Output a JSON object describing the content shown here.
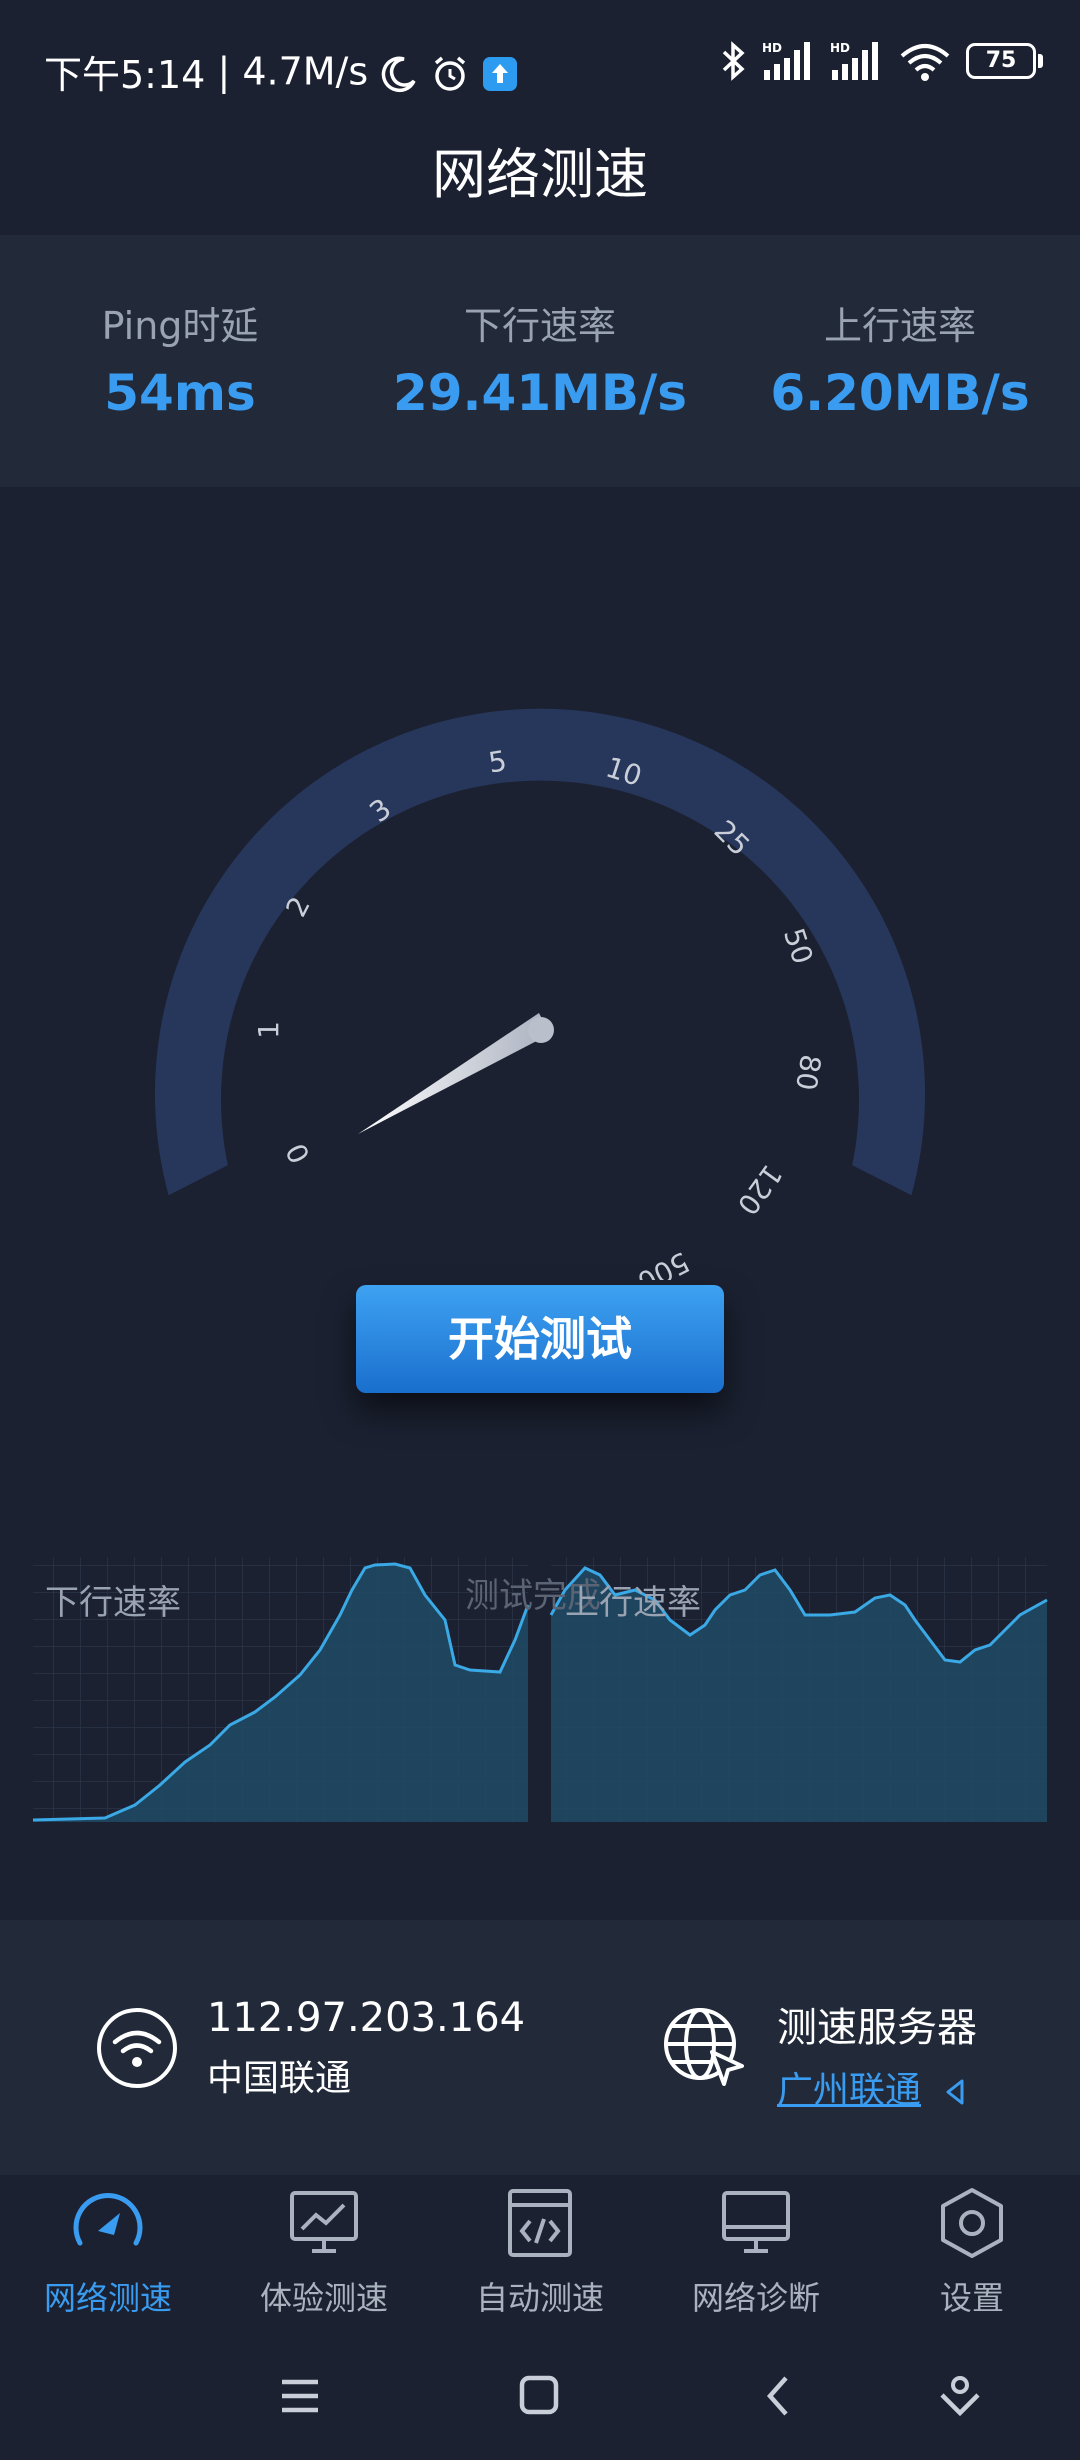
{
  "status_bar": {
    "time": "下午5:14",
    "speed": "4.7M/s",
    "battery": "75",
    "colors": {
      "icon": "#ffffff",
      "notification_badge": "#2d9cf0"
    }
  },
  "app": {
    "title": "网络测速"
  },
  "stats": [
    {
      "label": "Ping时延",
      "value": "54ms"
    },
    {
      "label": "下行速率",
      "value": "29.41MB/s"
    },
    {
      "label": "上行速率",
      "value": "6.20MB/s"
    }
  ],
  "gauge": {
    "ticks": [
      "0",
      "1",
      "2",
      "3",
      "5",
      "10",
      "25",
      "50",
      "80",
      "120",
      "500"
    ],
    "needle_value_fraction": 0.0,
    "colors": {
      "track": "#27375b",
      "dial": "#1b2131",
      "needle": "#c9ced8"
    }
  },
  "start_button": {
    "label": "开始测试"
  },
  "charts": {
    "download_label": "下行速率",
    "upload_label": "上行速率",
    "status_text": "测试完成",
    "colors": {
      "line": "#3aa9e6",
      "fill": "#1e4a66",
      "grid": "#2a3548"
    }
  },
  "info": {
    "ip": "112.97.203.164",
    "isp": "中国联通",
    "server_title": "测速服务器",
    "server_name": "广州联通"
  },
  "nav": [
    {
      "label": "网络测速",
      "icon": "speedometer-icon",
      "active": true
    },
    {
      "label": "体验测速",
      "icon": "chart-monitor-icon",
      "active": false
    },
    {
      "label": "自动测速",
      "icon": "code-window-icon",
      "active": false
    },
    {
      "label": "网络诊断",
      "icon": "monitor-icon",
      "active": false
    },
    {
      "label": "设置",
      "icon": "hexagon-gear-icon",
      "active": false
    }
  ],
  "theme": {
    "accent": "#3a9cf0",
    "background": "#1b2131",
    "panel": "#222a3a"
  }
}
